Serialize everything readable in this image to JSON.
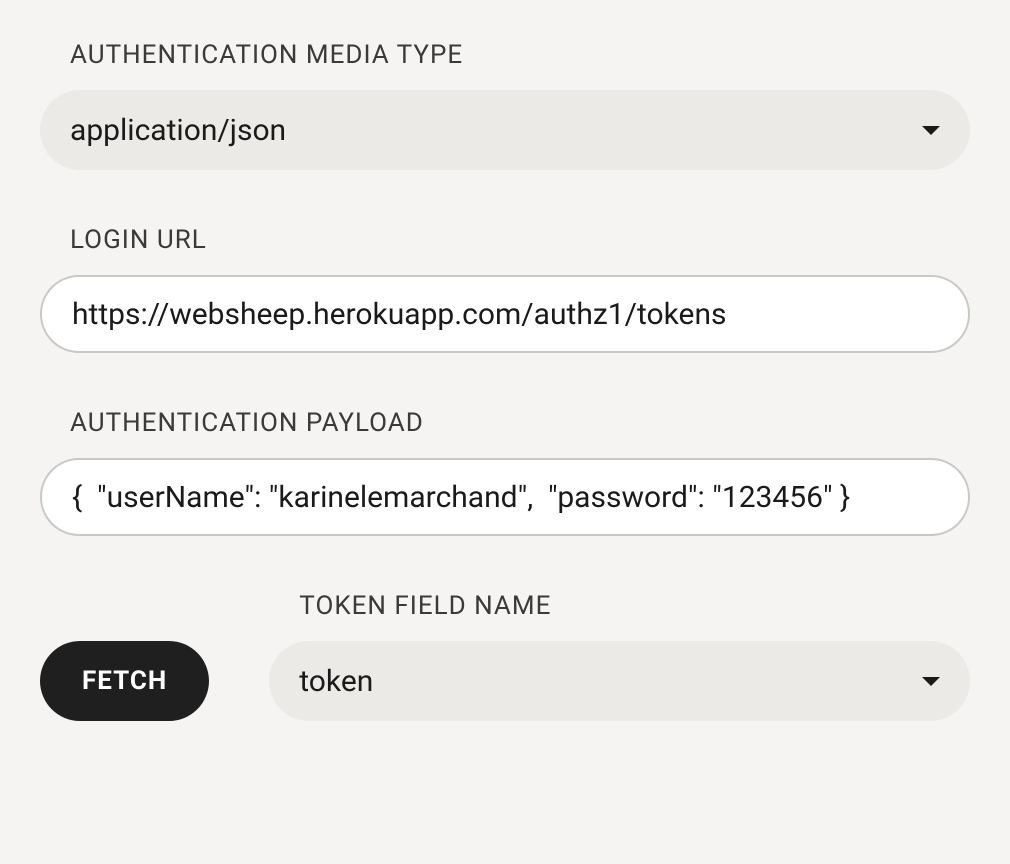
{
  "mediaType": {
    "label": "AUTHENTICATION MEDIA TYPE",
    "value": "application/json"
  },
  "loginUrl": {
    "label": "LOGIN URL",
    "value": "https://websheep.herokuapp.com/authz1/tokens"
  },
  "authPayload": {
    "label": "AUTHENTICATION PAYLOAD",
    "value": "{  \"userName\": \"karinelemarchand\",  \"password\": \"123456\" }"
  },
  "tokenField": {
    "label": "TOKEN FIELD NAME",
    "value": "token"
  },
  "fetchButton": {
    "label": "FETCH"
  }
}
